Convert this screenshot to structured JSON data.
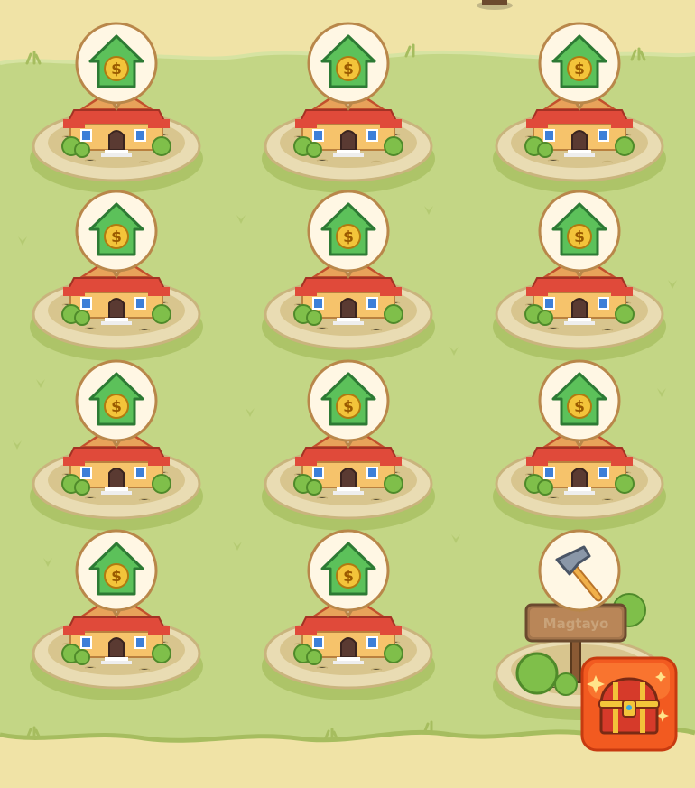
{
  "game": {
    "colors": {
      "grass": "#c3d685",
      "grass_dark": "#a6bd5f",
      "sand": "#f0e3a6",
      "plot_ring": "#e9dcb3",
      "plot_inner": "#d8c58e",
      "roof": "#e04a3a",
      "wall": "#f6c36b",
      "badge_green": "#5cc15a",
      "coin_gold": "#f3c43a",
      "chest_bg": "#f25a20"
    },
    "plots": [
      {
        "id": 1,
        "status": "collect",
        "icon": "house-dollar-icon"
      },
      {
        "id": 2,
        "status": "collect",
        "icon": "house-dollar-icon"
      },
      {
        "id": 3,
        "status": "collect",
        "icon": "house-dollar-icon"
      },
      {
        "id": 4,
        "status": "collect",
        "icon": "house-dollar-icon"
      },
      {
        "id": 5,
        "status": "collect",
        "icon": "house-dollar-icon"
      },
      {
        "id": 6,
        "status": "collect",
        "icon": "house-dollar-icon"
      },
      {
        "id": 7,
        "status": "collect",
        "icon": "house-dollar-icon"
      },
      {
        "id": 8,
        "status": "collect",
        "icon": "house-dollar-icon"
      },
      {
        "id": 9,
        "status": "collect",
        "icon": "house-dollar-icon"
      },
      {
        "id": 10,
        "status": "collect",
        "icon": "house-dollar-icon"
      },
      {
        "id": 11,
        "status": "collect",
        "icon": "house-dollar-icon"
      },
      {
        "id": 12,
        "status": "build",
        "icon": "hammer-icon",
        "sign_label": "Magtayo"
      }
    ],
    "treasure_chest": {
      "icon": "treasure-chest-icon"
    }
  }
}
